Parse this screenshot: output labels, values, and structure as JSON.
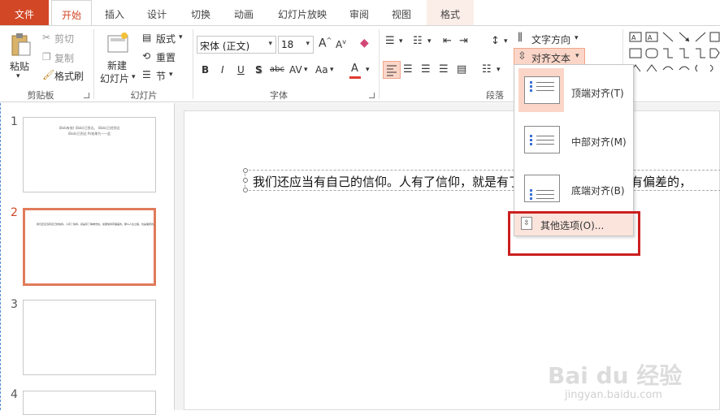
{
  "tabs": [
    {
      "label": "文件"
    },
    {
      "label": "开始"
    },
    {
      "label": "插入"
    },
    {
      "label": "设计"
    },
    {
      "label": "切换"
    },
    {
      "label": "动画"
    },
    {
      "label": "幻灯片放映"
    },
    {
      "label": "审阅"
    },
    {
      "label": "视图"
    },
    {
      "label": "格式"
    }
  ],
  "clipboard": {
    "paste": "粘贴",
    "cut": "剪切",
    "copy": "复制",
    "format_painter": "格式刷",
    "group": "剪贴板"
  },
  "slides_group": {
    "new_slide": "新建",
    "new_slide2": "幻灯片",
    "layout": "版式",
    "reset": "重置",
    "section": "节",
    "group": "幻灯片"
  },
  "font": {
    "name": "宋体 (正文)",
    "size": "18",
    "bold": "B",
    "italic": "I",
    "underline": "U",
    "shadow": "S",
    "strike": "abc",
    "spacing": "AV",
    "case": "Aa",
    "color": "A",
    "group": "字体"
  },
  "paragraph": {
    "text_direction": "文字方向",
    "align_text": "对齐文本",
    "group": "段落"
  },
  "align_menu": {
    "items": [
      {
        "label": "顶端对齐(T)"
      },
      {
        "label": "中部对齐(M)"
      },
      {
        "label": "底端对齐(B)"
      }
    ],
    "more": "其他选项(O)..."
  },
  "slide_numbers": [
    "1",
    "2",
    "3",
    "4"
  ],
  "thumb1": {
    "line1": "(Bob有效) (Bob)已到达。 (Bob)已经到达",
    "line2": "(Bob)已到达   Ps效果为一一此"
  },
  "thumb2": {
    "text": "我们还应当有自己的信仰。人有了信仰，就是有了精神支柱，如果信仰有偏差的，那么人生之路，也是偏离的。"
  },
  "slide_text": "我们还应当有自己的信仰。人有了信仰，就是有了精神支柱，如果信仰有偏差的，",
  "watermark": {
    "brand": "Bai du 经验",
    "url": "jingyan.baidu.com"
  },
  "colors": {
    "accent": "#d24726",
    "highlight": "#fbd6c8",
    "red_box": "#cc1f1f"
  }
}
